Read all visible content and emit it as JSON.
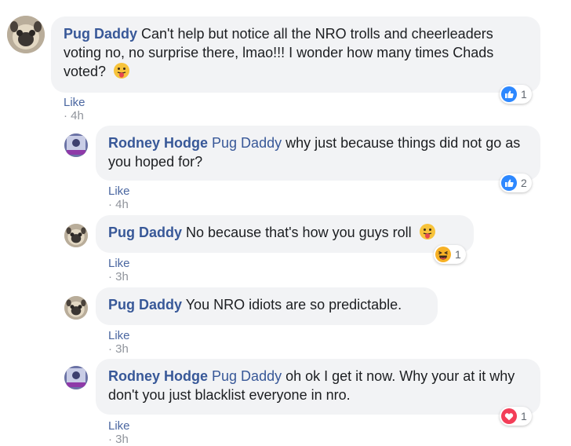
{
  "comments": [
    {
      "author": "Pug Daddy",
      "mention": "",
      "text": "Can't help but notice all the NRO trolls and cheerleaders voting no, no surprise there, lmao!!! I wonder how many times Chads voted?",
      "emoji": "tongue-out-emoji",
      "like_label": "Like",
      "sep": " · ",
      "time": "4h",
      "reaction": {
        "type": "like",
        "icon": "thumbs-up-icon",
        "color": "#2d88ff",
        "count": "1"
      }
    },
    {
      "author": "Rodney Hodge",
      "mention": "Pug Daddy",
      "text": "why just because things did not go as you hoped for?",
      "like_label": "Like",
      "sep": " · ",
      "time": "4h",
      "reaction": {
        "type": "like",
        "icon": "thumbs-up-icon",
        "color": "#2d88ff",
        "count": "2"
      }
    },
    {
      "author": "Pug Daddy",
      "mention": "",
      "text": "No because that's how you guys roll",
      "emoji": "tongue-out-emoji",
      "like_label": "Like",
      "sep": " · ",
      "time": "3h",
      "reaction": {
        "type": "haha",
        "icon": "laughing-face-icon",
        "color": "#f7b125",
        "count": "1"
      }
    },
    {
      "author": "Pug Daddy",
      "mention": "",
      "text": "You NRO idiots are so predictable.",
      "like_label": "Like",
      "sep": " · ",
      "time": "3h"
    },
    {
      "author": "Rodney Hodge",
      "mention": "Pug Daddy",
      "text": "oh ok I get it now. Why your at it why don't you just blacklist everyone in nro.",
      "like_label": "Like",
      "sep": " · ",
      "time": "3h",
      "reaction": {
        "type": "love",
        "icon": "heart-icon",
        "color": "#f33e58",
        "count": "1"
      }
    }
  ]
}
